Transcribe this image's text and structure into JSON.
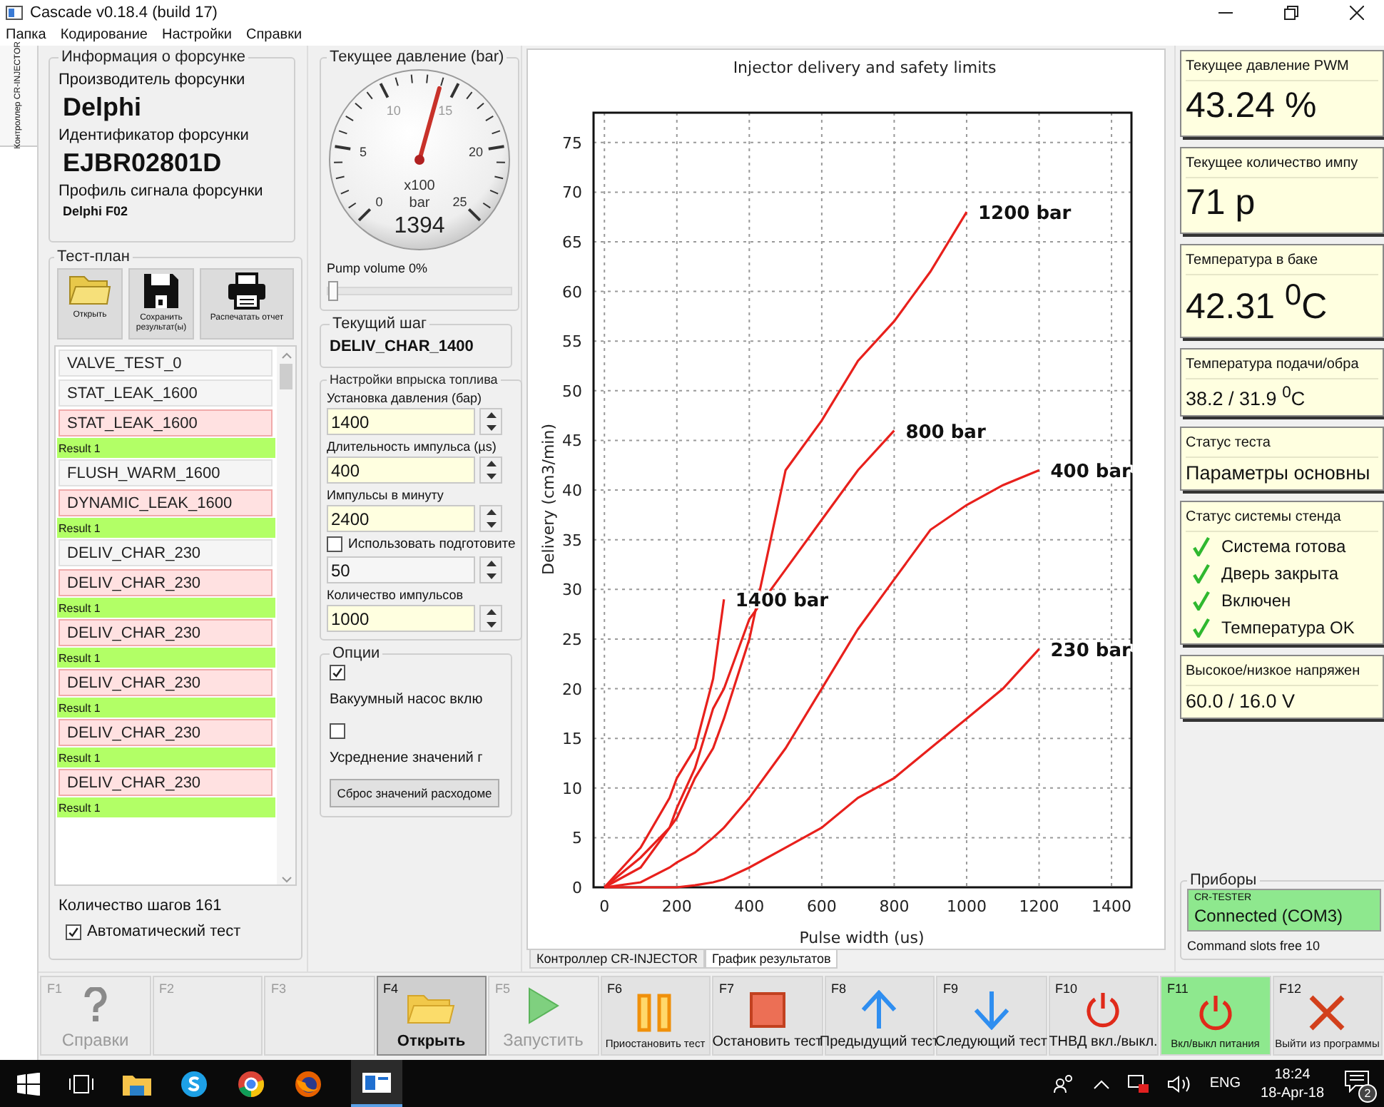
{
  "window": {
    "title": "Cascade v0.18.4 (build 17)"
  },
  "menu": [
    "Папка",
    "Кодирование",
    "Настройки",
    "Справки"
  ],
  "side_tab": {
    "label": "Контроллер CR-INJECTOR"
  },
  "injector_info": {
    "title": "Информация о форсунке",
    "fields": [
      {
        "label": "Производитель форсунки",
        "value": "Delphi",
        "kind": "big"
      },
      {
        "label": "Идентификатор форсунки",
        "value": "EJBR02801D",
        "kind": "big"
      },
      {
        "label": "Профиль сигнала форсунки",
        "value": "Delphi F02",
        "kind": "small"
      }
    ]
  },
  "test_plan": {
    "title": "Тест-план",
    "tools": [
      {
        "label": "Открыть",
        "kind": "open"
      },
      {
        "label": "Сохранить результат(ы)",
        "kind": "save"
      },
      {
        "label": "Распечатать отчет",
        "kind": "print"
      }
    ],
    "steps": [
      {
        "kind": "step",
        "label": "VALVE_TEST_0",
        "highlighted": false
      },
      {
        "kind": "step",
        "label": "STAT_LEAK_1600",
        "highlighted": false
      },
      {
        "kind": "step",
        "label": "STAT_LEAK_1600",
        "highlighted": true
      },
      {
        "kind": "result",
        "label": "Result 1"
      },
      {
        "kind": "step",
        "label": "FLUSH_WARM_1600",
        "highlighted": false
      },
      {
        "kind": "step",
        "label": "DYNAMIC_LEAK_1600",
        "highlighted": true
      },
      {
        "kind": "result",
        "label": "Result 1"
      },
      {
        "kind": "step",
        "label": "DELIV_CHAR_230",
        "highlighted": false
      },
      {
        "kind": "step",
        "label": "DELIV_CHAR_230",
        "highlighted": true
      },
      {
        "kind": "result",
        "label": "Result 1"
      },
      {
        "kind": "step",
        "label": "DELIV_CHAR_230",
        "highlighted": true
      },
      {
        "kind": "result",
        "label": "Result 1"
      },
      {
        "kind": "step",
        "label": "DELIV_CHAR_230",
        "highlighted": true
      },
      {
        "kind": "result",
        "label": "Result 1"
      },
      {
        "kind": "step",
        "label": "DELIV_CHAR_230",
        "highlighted": true
      },
      {
        "kind": "result",
        "label": "Result 1"
      },
      {
        "kind": "step",
        "label": "DELIV_CHAR_230",
        "highlighted": true
      },
      {
        "kind": "result",
        "label": "Result 1"
      }
    ],
    "step_count": "Количество шагов 161",
    "auto_test": {
      "label": "Автоматический тест",
      "checked": true
    }
  },
  "pressure": {
    "title": "Текущее давление (bar)",
    "scale": [
      "0",
      "5",
      "10",
      "15",
      "20",
      "25"
    ],
    "unit_top": "x100",
    "unit_bottom": "bar",
    "reading": "1394",
    "level": 0.5576,
    "pump_label": "Pump volume 0%",
    "pump": {
      "level": 0
    }
  },
  "current_step": {
    "title": "Текущий шаг",
    "value": "DELIV_CHAR_1400"
  },
  "injection": {
    "title": "Настройки впрыска топлива",
    "rows": [
      {
        "kind": "spin",
        "label": "Установка давления (бар)",
        "value": "1400",
        "highlighted": true
      },
      {
        "kind": "spin",
        "label": "Длительность импульса (µs)",
        "value": "400",
        "highlighted": true
      },
      {
        "kind": "spin",
        "label": "Импульсы в минуту",
        "value": "2400",
        "highlighted": true
      },
      {
        "kind": "check",
        "label": "Использовать подготовите",
        "checked": false
      },
      {
        "kind": "spin",
        "value": "50",
        "highlighted": false
      },
      {
        "kind": "spin",
        "label": "Количество импульсов",
        "value": "1000",
        "highlighted": true
      }
    ]
  },
  "options": {
    "title": "Опции",
    "checks": [
      {
        "label": "Вакуумный насос вклю",
        "checked": true
      },
      {
        "label": "Усреднение значений г",
        "checked": false
      }
    ],
    "button": "Сброс значений расходоме"
  },
  "chart": {
    "chart_data": {
      "type": "line",
      "title": "Injector delivery and safety limits",
      "xlabel": "Pulse width (us)",
      "ylabel": "Delivery (cm3/min)",
      "x": [
        0,
        100,
        180,
        200,
        250,
        300,
        330,
        400,
        500,
        600,
        700,
        800,
        900,
        1000,
        1100,
        1200
      ],
      "xlim": [
        -30,
        1455
      ],
      "ylim": [
        0,
        78
      ],
      "grid": true,
      "xticks": [
        0,
        200,
        400,
        600,
        800,
        1000,
        1200,
        1400
      ],
      "yticks": [
        0,
        5,
        10,
        15,
        20,
        25,
        30,
        35,
        40,
        45,
        50,
        55,
        60,
        65,
        70,
        75
      ],
      "series": [
        {
          "name": "1400 bar",
          "color": "#e8201c",
          "values": [
            0,
            4,
            9,
            11,
            14,
            21,
            29,
            null,
            null,
            null,
            null,
            null,
            null,
            null,
            null,
            null
          ]
        },
        {
          "name": "1200 bar",
          "color": "#e8201c",
          "values": [
            0,
            3,
            6,
            7,
            11,
            14,
            17,
            25,
            42,
            47,
            53,
            57,
            62,
            68,
            null,
            null
          ]
        },
        {
          "name": "800 bar",
          "color": "#e8201c",
          "values": [
            0,
            2,
            6,
            8,
            12,
            18,
            20,
            27,
            32,
            37,
            42,
            46,
            null,
            null,
            null,
            null
          ]
        },
        {
          "name": "400 bar",
          "color": "#e8201c",
          "values": [
            0,
            0.5,
            2,
            2.5,
            3.5,
            5,
            6,
            9,
            14,
            20,
            26,
            31,
            36,
            38.5,
            40.5,
            42
          ]
        },
        {
          "name": "230 bar",
          "color": "#e8201c",
          "values": [
            0,
            0,
            0,
            0,
            0.2,
            0.5,
            0.8,
            2,
            4,
            6,
            9,
            11,
            14,
            17,
            20,
            24
          ]
        }
      ]
    }
  },
  "bottom_tabs": [
    {
      "label": "Контроллер CR-INJECTOR",
      "selected": false
    },
    {
      "label": "График результатов",
      "selected": true
    }
  ],
  "panels": [
    {
      "kind": "big",
      "title": "Текущее давление PWM",
      "value": "43.24 %"
    },
    {
      "kind": "big",
      "title": "Текущее количество импу",
      "value": "71 p"
    },
    {
      "kind": "big",
      "title": "Температура в баке",
      "value": "42.31 $^{0}$C"
    },
    {
      "kind": "medium",
      "title": "Температура подачи/обра",
      "value": "38.2 / 31.9 $^{0}$C"
    },
    {
      "kind": "medium",
      "title": "Статус теста",
      "value": "Параметры основны"
    },
    {
      "kind": "status",
      "title": "Статус системы стенда",
      "items": [
        {
          "label": "Система готова",
          "ok": true
        },
        {
          "label": "Дверь закрыта",
          "ok": true
        },
        {
          "label": "Включен",
          "ok": true
        },
        {
          "label": "Температура OK",
          "ok": true
        }
      ]
    },
    {
      "kind": "medium",
      "title": "Высокое/низкое напряжен",
      "value": "60.0 / 16.0 V"
    }
  ],
  "devices": {
    "title": "Приборы",
    "device": {
      "name": "CR-TESTER",
      "status": "Connected (COM3)",
      "connected": true
    },
    "slots": "Command slots free 10"
  },
  "fkeys": [
    {
      "key": "F1",
      "label": "Справки",
      "kind": "help",
      "disabled": true,
      "selected": false,
      "on": false
    },
    {
      "key": "F2",
      "kind": "blank",
      "disabled": true,
      "selected": false,
      "on": false
    },
    {
      "key": "F3",
      "kind": "blank",
      "disabled": true,
      "selected": false,
      "on": false
    },
    {
      "key": "F4",
      "label": "Открыть",
      "kind": "open",
      "disabled": false,
      "selected": true,
      "on": false
    },
    {
      "key": "F5",
      "label": "Запустить",
      "kind": "start",
      "disabled": true,
      "selected": false,
      "on": false
    },
    {
      "key": "F6",
      "label": "Приостановить тест",
      "kind": "pause",
      "disabled": false,
      "selected": false,
      "on": false
    },
    {
      "key": "F7",
      "label": "Остановить тест",
      "kind": "stop",
      "disabled": false,
      "selected": false,
      "on": false
    },
    {
      "key": "F8",
      "label": "Предыдущий тест",
      "kind": "previous",
      "disabled": false,
      "selected": false,
      "on": false
    },
    {
      "key": "F9",
      "label": "Следующий тест",
      "kind": "next",
      "disabled": false,
      "selected": false,
      "on": false
    },
    {
      "key": "F10",
      "label": "ТНВД вкл./выкл.",
      "kind": "power",
      "disabled": false,
      "selected": false,
      "on": false
    },
    {
      "key": "F11",
      "label": "Вкл/выкл питания",
      "kind": "power",
      "disabled": false,
      "selected": false,
      "on": true
    },
    {
      "key": "F12",
      "label": "Выйти из программы",
      "kind": "exit",
      "disabled": false,
      "selected": false,
      "on": false
    }
  ],
  "taskbar": {
    "language": "ENG",
    "time": "18:24",
    "date": "18-Apr-18",
    "notifications": "2"
  }
}
